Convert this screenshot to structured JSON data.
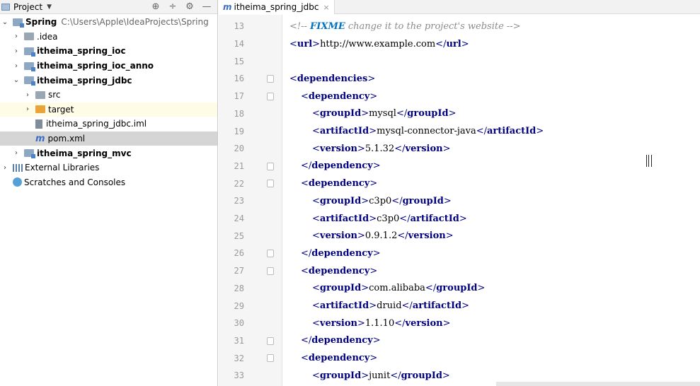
{
  "project_panel": {
    "title": "Project",
    "tree": [
      {
        "label": "Spring",
        "path": "C:\\Users\\Apple\\IdeaProjects\\Spring",
        "arrow": "⌄",
        "indent": 0,
        "icon": "folder-module",
        "bold": true
      },
      {
        "label": ".idea",
        "arrow": "›",
        "indent": 1,
        "icon": "folder-gray"
      },
      {
        "label": "itheima_spring_ioc",
        "arrow": "›",
        "indent": 1,
        "icon": "folder-module",
        "bold": true
      },
      {
        "label": "itheima_spring_ioc_anno",
        "arrow": "›",
        "indent": 1,
        "icon": "folder-module",
        "bold": true
      },
      {
        "label": "itheima_spring_jdbc",
        "arrow": "⌄",
        "indent": 1,
        "icon": "folder-module",
        "bold": true
      },
      {
        "label": "src",
        "arrow": "›",
        "indent": 2,
        "icon": "folder-gray"
      },
      {
        "label": "target",
        "arrow": "›",
        "indent": 2,
        "icon": "folder-orange",
        "highlight": true
      },
      {
        "label": "itheima_spring_jdbc.iml",
        "arrow": "",
        "indent": 2,
        "icon": "file-iml"
      },
      {
        "label": "pom.xml",
        "arrow": "",
        "indent": 2,
        "icon": "maven-file",
        "selected": true
      },
      {
        "label": "itheima_spring_mvc",
        "arrow": "›",
        "indent": 1,
        "icon": "folder-module",
        "bold": true
      },
      {
        "label": "External Libraries",
        "arrow": "›",
        "indent": 0,
        "icon": "library-icon"
      },
      {
        "label": "Scratches and Consoles",
        "arrow": "",
        "indent": 0,
        "icon": "scratch-icon"
      }
    ]
  },
  "editor": {
    "tab_label": "itheima_spring_jdbc",
    "tab_icon": "m",
    "lines": [
      {
        "n": "13",
        "depth": 0,
        "kind": "comment",
        "pre": "<!-- ",
        "todo": "FIXME",
        "post": " change it to the project's website -->"
      },
      {
        "n": "14",
        "depth": 0,
        "kind": "element",
        "tag": "url",
        "value": "http://www.example.com"
      },
      {
        "n": "15",
        "depth": 0,
        "kind": "empty"
      },
      {
        "n": "16",
        "depth": 0,
        "kind": "open",
        "tag": "dependencies",
        "fold": true
      },
      {
        "n": "17",
        "depth": 1,
        "kind": "open",
        "tag": "dependency",
        "fold": true
      },
      {
        "n": "18",
        "depth": 2,
        "kind": "element",
        "tag": "groupId",
        "value": "mysql"
      },
      {
        "n": "19",
        "depth": 2,
        "kind": "element",
        "tag": "artifactId",
        "value": "mysql-connector-java"
      },
      {
        "n": "20",
        "depth": 2,
        "kind": "element",
        "tag": "version",
        "value": "5.1.32"
      },
      {
        "n": "21",
        "depth": 1,
        "kind": "close",
        "tag": "dependency",
        "fold": true
      },
      {
        "n": "22",
        "depth": 1,
        "kind": "open",
        "tag": "dependency",
        "fold": true
      },
      {
        "n": "23",
        "depth": 2,
        "kind": "element",
        "tag": "groupId",
        "value": "c3p0"
      },
      {
        "n": "24",
        "depth": 2,
        "kind": "element",
        "tag": "artifactId",
        "value": "c3p0"
      },
      {
        "n": "25",
        "depth": 2,
        "kind": "element",
        "tag": "version",
        "value": "0.9.1.2"
      },
      {
        "n": "26",
        "depth": 1,
        "kind": "close",
        "tag": "dependency",
        "fold": true
      },
      {
        "n": "27",
        "depth": 1,
        "kind": "open",
        "tag": "dependency",
        "fold": true
      },
      {
        "n": "28",
        "depth": 2,
        "kind": "element",
        "tag": "groupId",
        "value": "com.alibaba"
      },
      {
        "n": "29",
        "depth": 2,
        "kind": "element",
        "tag": "artifactId",
        "value": "druid"
      },
      {
        "n": "30",
        "depth": 2,
        "kind": "element",
        "tag": "version",
        "value": "1.1.10"
      },
      {
        "n": "31",
        "depth": 1,
        "kind": "close",
        "tag": "dependency",
        "fold": true
      },
      {
        "n": "32",
        "depth": 1,
        "kind": "open",
        "tag": "dependency",
        "fold": true
      },
      {
        "n": "33",
        "depth": 2,
        "kind": "element",
        "tag": "groupId",
        "value": "junit"
      }
    ]
  }
}
